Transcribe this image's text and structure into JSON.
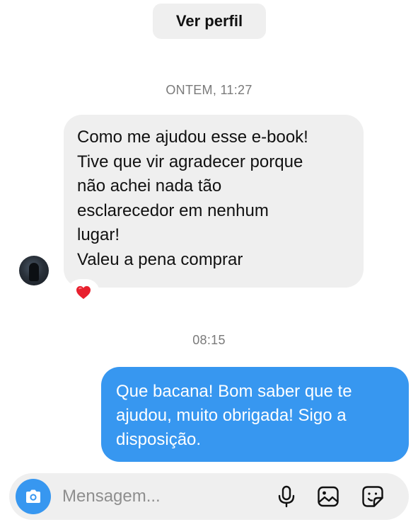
{
  "header": {
    "profile_button": "Ver perfil"
  },
  "thread": {
    "timestamp_1": "ONTEM, 11:27",
    "incoming": {
      "lines": [
        "Como me ajudou esse e-book!",
        "Tive que vir agradecer porque",
        "não achei nada tão",
        "esclarecedor em nenhum",
        "lugar!",
        "Valeu a pena comprar"
      ],
      "reaction": "❤️"
    },
    "timestamp_2": "08:15",
    "outgoing": {
      "lines": [
        "Que bacana! Bom saber que te",
        "ajudou, muito obrigada! Sigo a",
        "disposição."
      ]
    }
  },
  "composer": {
    "placeholder": "Mensagem...",
    "icons": [
      "camera-icon",
      "microphone-icon",
      "gallery-icon",
      "sticker-icon"
    ]
  },
  "colors": {
    "accent": "#3797f0",
    "bubble_incoming": "#efefef",
    "heart": "#e8202e"
  }
}
